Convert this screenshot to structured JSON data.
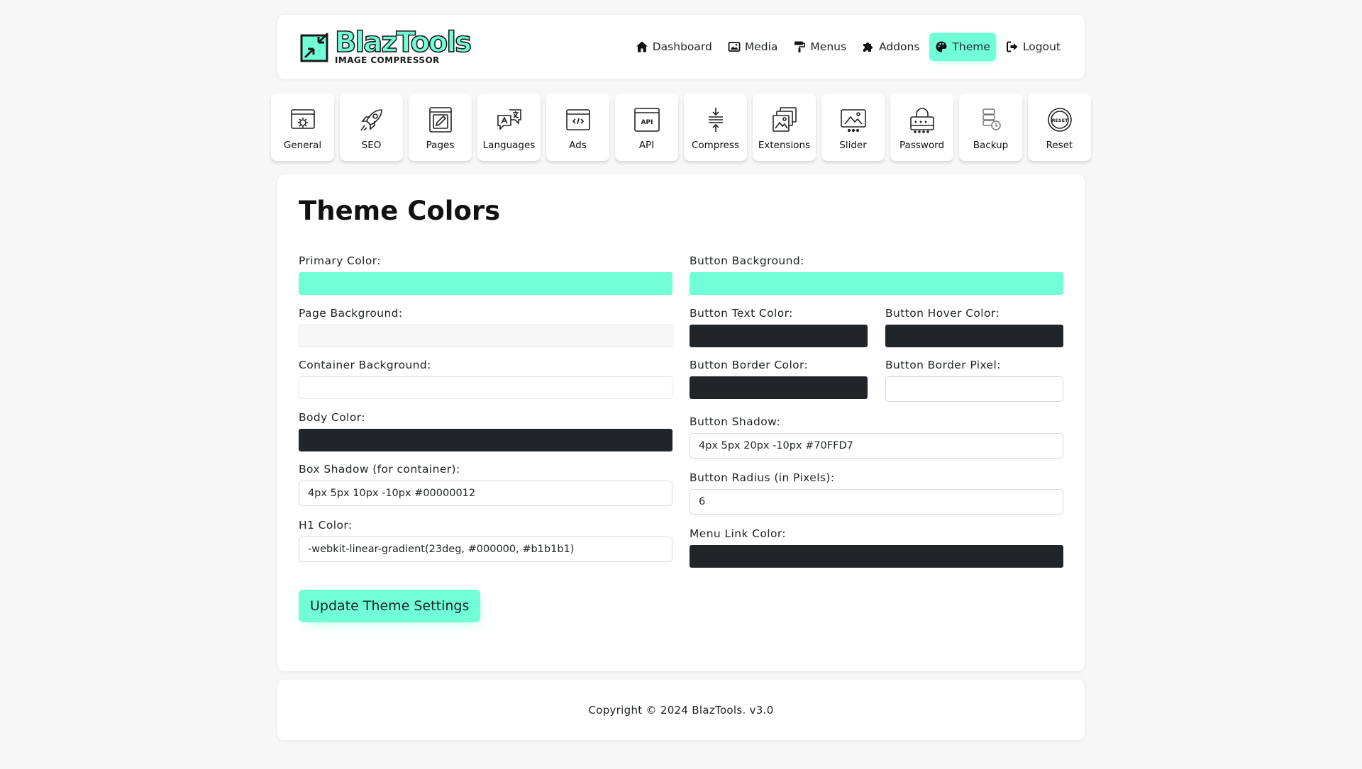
{
  "brand": {
    "title": "BlazTools",
    "subtitle": "IMAGE COMPRESSOR"
  },
  "nav": [
    {
      "label": "Dashboard",
      "icon": "home-icon"
    },
    {
      "label": "Media",
      "icon": "image-icon"
    },
    {
      "label": "Menus",
      "icon": "paint-roller-icon"
    },
    {
      "label": "Addons",
      "icon": "puzzle-icon"
    },
    {
      "label": "Theme",
      "icon": "palette-icon",
      "active": true
    },
    {
      "label": "Logout",
      "icon": "logout-icon"
    }
  ],
  "tiles": [
    {
      "label": "General",
      "icon": "general-settings-icon"
    },
    {
      "label": "SEO",
      "icon": "rocket-icon"
    },
    {
      "label": "Pages",
      "icon": "pages-icon"
    },
    {
      "label": "Languages",
      "icon": "languages-icon"
    },
    {
      "label": "Ads",
      "icon": "ads-code-icon"
    },
    {
      "label": "API",
      "icon": "api-icon"
    },
    {
      "label": "Compress",
      "icon": "compress-icon"
    },
    {
      "label": "Extensions",
      "icon": "extensions-icon"
    },
    {
      "label": "Slider",
      "icon": "slider-icon"
    },
    {
      "label": "Password",
      "icon": "password-icon"
    },
    {
      "label": "Backup",
      "icon": "backup-icon"
    },
    {
      "label": "Reset",
      "icon": "reset-icon"
    }
  ],
  "form": {
    "heading": "Theme Colors",
    "primary_color": {
      "label": "Primary Color:",
      "value": "#70ffd7"
    },
    "page_background": {
      "label": "Page Background:",
      "value": "#f7f7f7"
    },
    "container_background": {
      "label": "Container Background:",
      "value": "#ffffff"
    },
    "body_color": {
      "label": "Body Color:",
      "value": "#212529"
    },
    "box_shadow": {
      "label": "Box Shadow (for container):",
      "value": "4px 5px 10px -10px #00000012"
    },
    "h1_color": {
      "label": "H1 Color:",
      "value": "-webkit-linear-gradient(23deg, #000000, #b1b1b1)"
    },
    "button_background": {
      "label": "Button Background:",
      "value": "#70ffd7"
    },
    "button_text_color": {
      "label": "Button Text Color:",
      "value": "#212529"
    },
    "button_hover_color": {
      "label": "Button Hover Color:",
      "value": "#212529"
    },
    "button_border_color": {
      "label": "Button Border Color:",
      "value": "#212529"
    },
    "button_border_pixel": {
      "label": "Button Border Pixel:",
      "value": ""
    },
    "button_shadow": {
      "label": "Button Shadow:",
      "value": "4px 5px 20px -10px #70FFD7"
    },
    "button_radius": {
      "label": "Button Radius (in Pixels):",
      "value": "6"
    },
    "menu_link_color": {
      "label": "Menu Link Color:",
      "value": "#212529"
    },
    "submit_label": "Update Theme Settings"
  },
  "footer": {
    "copyright": "Copyright © 2024 BlazTools. v3.0"
  }
}
